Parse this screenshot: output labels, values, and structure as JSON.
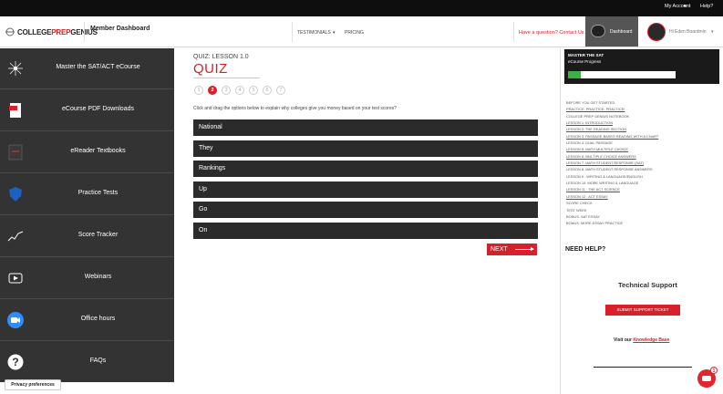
{
  "topbar": {
    "my_account": "My Account",
    "help": "Help?"
  },
  "header": {
    "logo_part1": "COLLEGE",
    "logo_part2": "PREP",
    "logo_part3": "GENIUS",
    "member_dashboard": "Member Dashboard",
    "nav_testimonials": "TESTIMONIALS",
    "nav_pricing": "PRICING",
    "question_link": "Have a question? Contact Us.",
    "dashboard_label": "Dashboard",
    "user_name": "Hi Eden Boardmin"
  },
  "sidebar": {
    "items": [
      {
        "label": "Master the SAT/ACT eCourse",
        "icon": "brain-icon"
      },
      {
        "label": "eCourse PDF Downloads",
        "icon": "pdf-icon"
      },
      {
        "label": "eReader Textbooks",
        "icon": "book-icon"
      },
      {
        "label": "Practice Tests",
        "icon": "shield-icon"
      },
      {
        "label": "Score Tracker",
        "icon": "trend-icon"
      },
      {
        "label": "Webinars",
        "icon": "play-icon"
      },
      {
        "label": "Office hours",
        "icon": "video-icon"
      },
      {
        "label": "FAQs",
        "icon": "question-icon"
      }
    ],
    "privacy": "Privacy preferences"
  },
  "quiz": {
    "lesson": "QUIZ: LESSON 1.0",
    "title": "QUIZ",
    "steps": [
      "1",
      "2",
      "3",
      "4",
      "5",
      "6",
      "7"
    ],
    "active_step": "2",
    "instructions": "Click and drag the options below to explain why colleges give you money based on your test scores?",
    "options": [
      "National",
      "They",
      "Rankings",
      "Up",
      "Go",
      "On"
    ],
    "next": "NEXT"
  },
  "progress": {
    "title": "MASTER THE SAT",
    "subtitle": "eCourse Progress",
    "fraction": 0.12,
    "colors": {
      "fill": "#3cb043"
    }
  },
  "lessons": [
    {
      "text": "BEFORE YOU GET STARTED",
      "u": false
    },
    {
      "text": "PRACTICE, PRACTICE, PRACTICE!",
      "u": true
    },
    {
      "text": "COLLEGE PREP GENIUS NOTEBOOK",
      "u": false
    },
    {
      "text": "LESSON 1: INTRODUCTION",
      "u": true
    },
    {
      "text": "LESSON 2: THE READING SECTION",
      "u": true
    },
    {
      "text": "LESSON 3: PASSAGE BASED READING WITH A CHART",
      "u": true
    },
    {
      "text": "LESSON 4: DUAL PASSAGE",
      "u": false
    },
    {
      "text": "LESSON 5: MATH MULTIPLE CHOICE",
      "u": true
    },
    {
      "text": "LESSON 6: MULTIPLE CHOICE ANSWERS",
      "u": true
    },
    {
      "text": "LESSON 7: MATH STUDENT RESPONSE (SAT)",
      "u": true
    },
    {
      "text": "LESSON 8: MATH STUDENT RESPONSE ANSWERS",
      "u": false
    },
    {
      "text": "LESSON 9 : WRITING & LANGUAGE/ENGLISH",
      "u": false
    },
    {
      "text": "LESSON 10: MORE WRITING & LANGUAGE",
      "u": false
    },
    {
      "text": "LESSON 11 : THE ACT SCIENCE",
      "u": true
    },
    {
      "text": "LESSON 12 : ACT ESSAY",
      "u": true
    },
    {
      "text": "SCORE CHECK",
      "u": false
    },
    {
      "text": "TEST WEEK",
      "u": false
    },
    {
      "text": "BONUS: SAT ESSAY",
      "u": false
    },
    {
      "text": "BONUS: MORE ESSAY PRACTICE",
      "u": false
    }
  ],
  "help": {
    "need_help": "NEED HELP?",
    "tech_support": "Technical Support",
    "ticket_button": "SUBMIT SUPPORT TICKET",
    "kb_prefix": "Visit our",
    "kb_link": "Knowledge Base"
  },
  "chat": {
    "badge": "1"
  },
  "colors": {
    "accent": "#d9202a",
    "sidebar_bg": "#333333",
    "option_bg": "#2b2b2b"
  }
}
